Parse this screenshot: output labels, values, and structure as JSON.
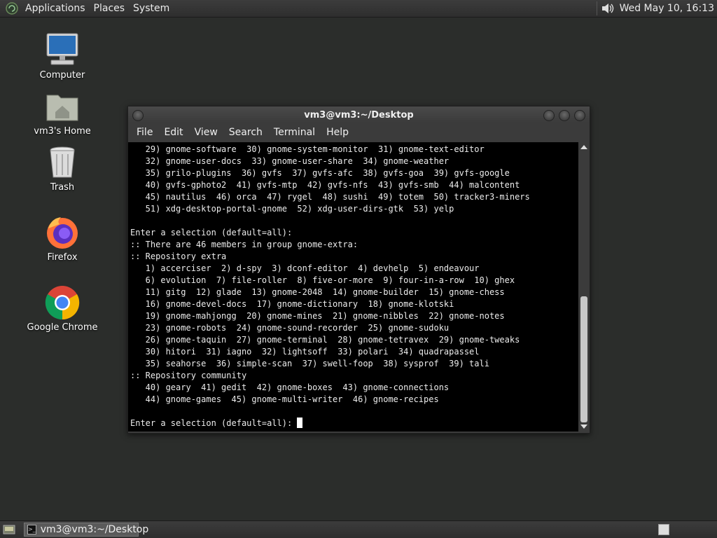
{
  "top_panel": {
    "menus": [
      "Applications",
      "Places",
      "System"
    ],
    "clock": "Wed May 10, 16:13"
  },
  "desktop_icons": [
    {
      "label": "Computer",
      "icon": "computer-icon"
    },
    {
      "label": "vm3's Home",
      "icon": "home-folder-icon"
    },
    {
      "label": "Trash",
      "icon": "trash-icon"
    },
    {
      "label": "Firefox",
      "icon": "firefox-icon"
    },
    {
      "label": "Google Chrome",
      "icon": "chrome-icon"
    }
  ],
  "terminal": {
    "title": "vm3@vm3:~/Desktop",
    "menus": [
      "File",
      "Edit",
      "View",
      "Search",
      "Terminal",
      "Help"
    ],
    "lines": [
      "   29) gnome-software  30) gnome-system-monitor  31) gnome-text-editor",
      "   32) gnome-user-docs  33) gnome-user-share  34) gnome-weather",
      "   35) grilo-plugins  36) gvfs  37) gvfs-afc  38) gvfs-goa  39) gvfs-google",
      "   40) gvfs-gphoto2  41) gvfs-mtp  42) gvfs-nfs  43) gvfs-smb  44) malcontent",
      "   45) nautilus  46) orca  47) rygel  48) sushi  49) totem  50) tracker3-miners",
      "   51) xdg-desktop-portal-gnome  52) xdg-user-dirs-gtk  53) yelp",
      "",
      "Enter a selection (default=all):",
      ":: There are 46 members in group gnome-extra:",
      ":: Repository extra",
      "   1) accerciser  2) d-spy  3) dconf-editor  4) devhelp  5) endeavour",
      "   6) evolution  7) file-roller  8) five-or-more  9) four-in-a-row  10) ghex",
      "   11) gitg  12) glade  13) gnome-2048  14) gnome-builder  15) gnome-chess",
      "   16) gnome-devel-docs  17) gnome-dictionary  18) gnome-klotski",
      "   19) gnome-mahjongg  20) gnome-mines  21) gnome-nibbles  22) gnome-notes",
      "   23) gnome-robots  24) gnome-sound-recorder  25) gnome-sudoku",
      "   26) gnome-taquin  27) gnome-terminal  28) gnome-tetravex  29) gnome-tweaks",
      "   30) hitori  31) iagno  32) lightsoff  33) polari  34) quadrapassel",
      "   35) seahorse  36) simple-scan  37) swell-foop  38) sysprof  39) tali",
      ":: Repository community",
      "   40) geary  41) gedit  42) gnome-boxes  43) gnome-connections",
      "   44) gnome-games  45) gnome-multi-writer  46) gnome-recipes",
      ""
    ],
    "prompt": "Enter a selection (default=all): "
  },
  "bottom_panel": {
    "task_label": "vm3@vm3:~/Desktop"
  }
}
